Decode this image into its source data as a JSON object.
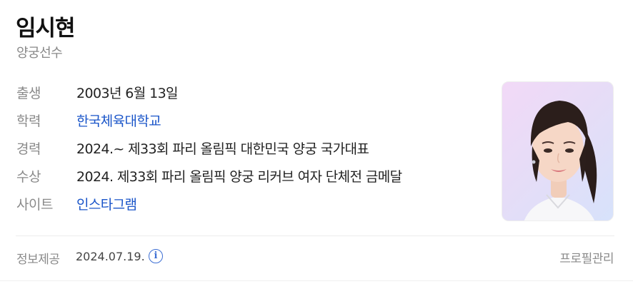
{
  "profile": {
    "name": "임시현",
    "subtitle": "양궁선수"
  },
  "info_rows": [
    {
      "label": "출생",
      "value": "2003년 6월 13일",
      "link": false
    },
    {
      "label": "학력",
      "value": "한국체육대학교",
      "link": true
    },
    {
      "label": "경력",
      "value": "2024.~ 제33회 파리 올림픽 대한민국 양궁 국가대표",
      "link": false
    },
    {
      "label": "수상",
      "value": "2024. 제33회 파리 올림픽 양궁 리커브 여자 단체전 금메달",
      "link": false
    },
    {
      "label": "사이트",
      "value": "인스타그램",
      "link": true
    }
  ],
  "footer": {
    "label": "정보제공",
    "date": "2024.07.19.",
    "info_icon": "i",
    "profile_manage": "프로필관리"
  },
  "colors": {
    "link": "#1a55c9",
    "label": "#8a8a8a",
    "photo_bg_start": "#f2d9f7",
    "photo_bg_end": "#d7e2fb"
  },
  "icons": {
    "info": "info-circle-icon"
  }
}
